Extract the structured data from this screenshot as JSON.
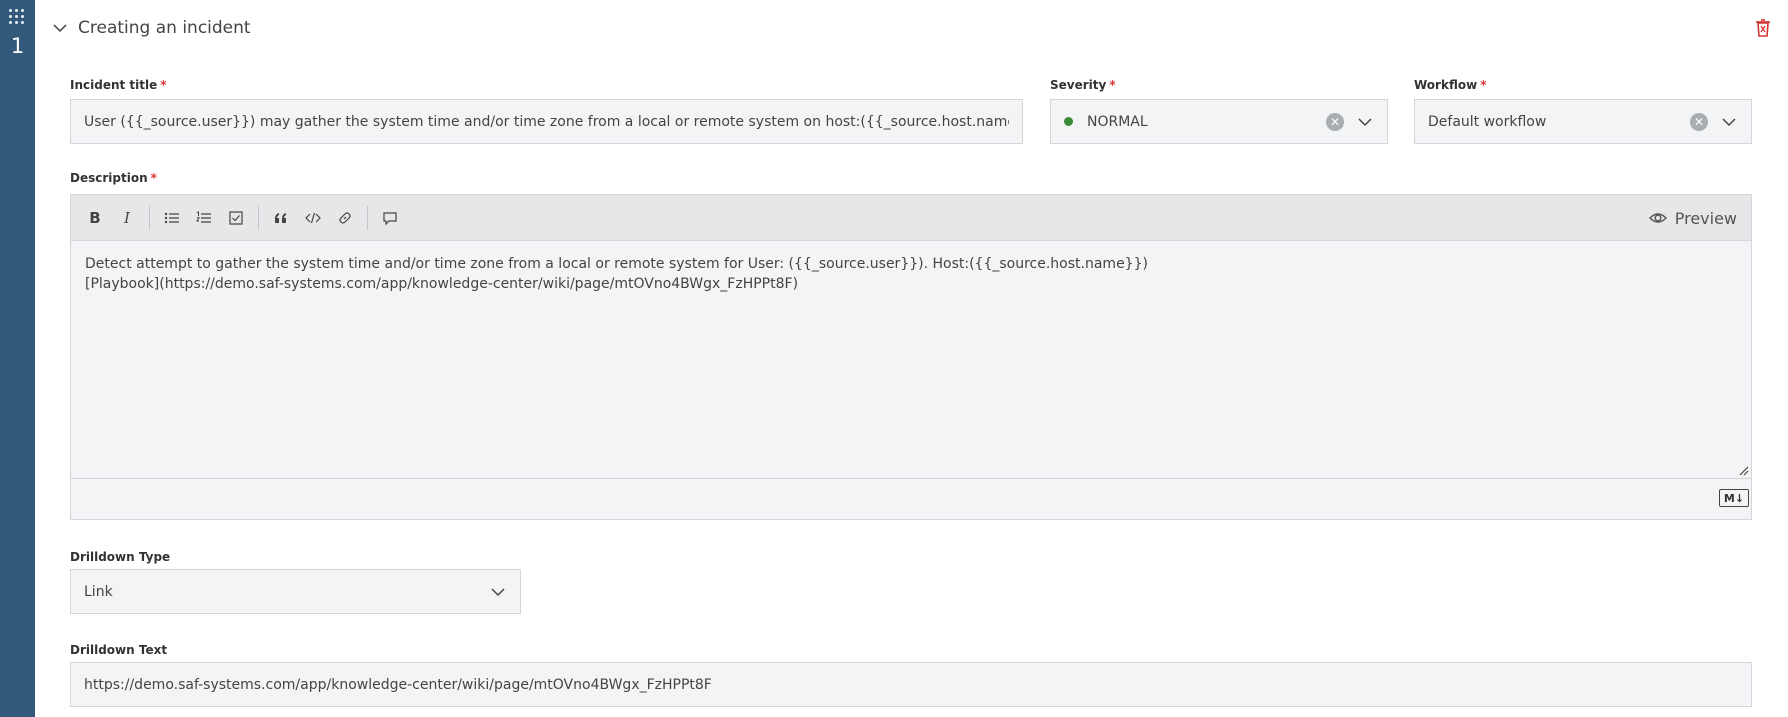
{
  "rail": {
    "step_number": "1"
  },
  "step": {
    "title": "Creating an incident"
  },
  "incident_title": {
    "label": "Incident title",
    "required": "*",
    "value": "User ({{_source.user}}) may gather the system time and/or time zone from a local or remote system on host:({{_source.host.name}})"
  },
  "severity": {
    "label": "Severity",
    "required": "*",
    "value": "NORMAL",
    "dot_color": "#3a8a3a"
  },
  "workflow": {
    "label": "Workflow",
    "required": "*",
    "value": "Default workflow"
  },
  "description": {
    "label": "Description",
    "required": "*",
    "toolbar": {
      "bold": "B",
      "italic": "I",
      "preview_label": "Preview"
    },
    "lines": [
      "Detect attempt to gather the system time and/or time zone from a local or remote system for User: ({{_source.user}}). Host:({{_source.host.name}})",
      "[Playbook](https://demo.saf-systems.com/app/knowledge-center/wiki/page/mtOVno4BWgx_FzHPPt8F)"
    ],
    "markdown_badge": "M↓"
  },
  "drilldown_type": {
    "label": "Drilldown Type",
    "value": "Link"
  },
  "drilldown_text": {
    "label": "Drilldown Text",
    "value": "https://demo.saf-systems.com/app/knowledge-center/wiki/page/mtOVno4BWgx_FzHPPt8F"
  },
  "colors": {
    "rail": "#335a7a",
    "required": "#dd3333",
    "trash": "#d33333"
  }
}
